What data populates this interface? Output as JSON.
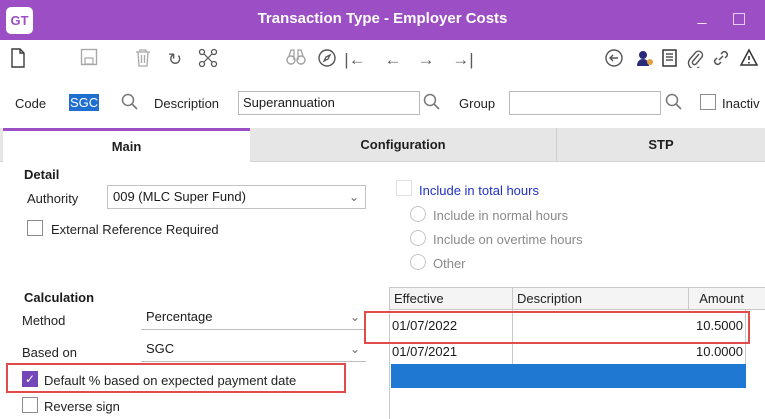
{
  "window": {
    "logo": "GT",
    "title": "Transaction Type - Employer Costs",
    "minimize": "_"
  },
  "toolbar": {
    "icons": [
      "new-document-icon",
      "save-icon",
      "delete-icon",
      "refresh-icon",
      "hierarchy-icon",
      "find-binoculars-icon",
      "navigate-compass-icon",
      "first-record-icon",
      "previous-record-icon",
      "next-record-icon",
      "last-record-icon",
      "back-circle-icon",
      "users-icon",
      "notes-icon",
      "attach-icon",
      "link-icon",
      "warning-icon"
    ]
  },
  "header": {
    "code_label": "Code",
    "code_value": "SGC",
    "description_label": "Description",
    "description_value": "Superannuation",
    "group_label": "Group",
    "group_value": "",
    "inactive_label": "Inactiv"
  },
  "tabs": [
    {
      "label": "Main",
      "active": true
    },
    {
      "label": "Configuration",
      "active": false
    },
    {
      "label": "STP",
      "active": false
    }
  ],
  "detail": {
    "heading": "Detail",
    "authority_label": "Authority",
    "authority_value": "009 (MLC Super Fund)",
    "external_ref_label": "External Reference Required",
    "external_ref_checked": false
  },
  "hours": {
    "include_total_label": "Include in total hours",
    "include_normal_label": "Include in normal hours",
    "include_overtime_label": "Include on overtime hours",
    "other_label": "Other"
  },
  "calculation": {
    "heading": "Calculation",
    "method_label": "Method",
    "method_value": "Percentage",
    "based_on_label": "Based on",
    "based_on_value": "SGC",
    "default_pct_label": "Default % based on expected payment date",
    "default_pct_checked": true,
    "reverse_sign_label": "Reverse sign",
    "reverse_sign_checked": false
  },
  "rates_table": {
    "columns": [
      "Effective",
      "Description",
      "Amount"
    ],
    "rows": [
      {
        "effective": "01/07/2022",
        "description": "",
        "amount": "10.5000"
      },
      {
        "effective": "01/07/2021",
        "description": "",
        "amount": "10.0000"
      }
    ]
  },
  "colors": {
    "titlebar": "#9c4fc4",
    "selection": "#1f78d1",
    "highlight": "#e24b4b",
    "checkbox": "#7447b8"
  }
}
